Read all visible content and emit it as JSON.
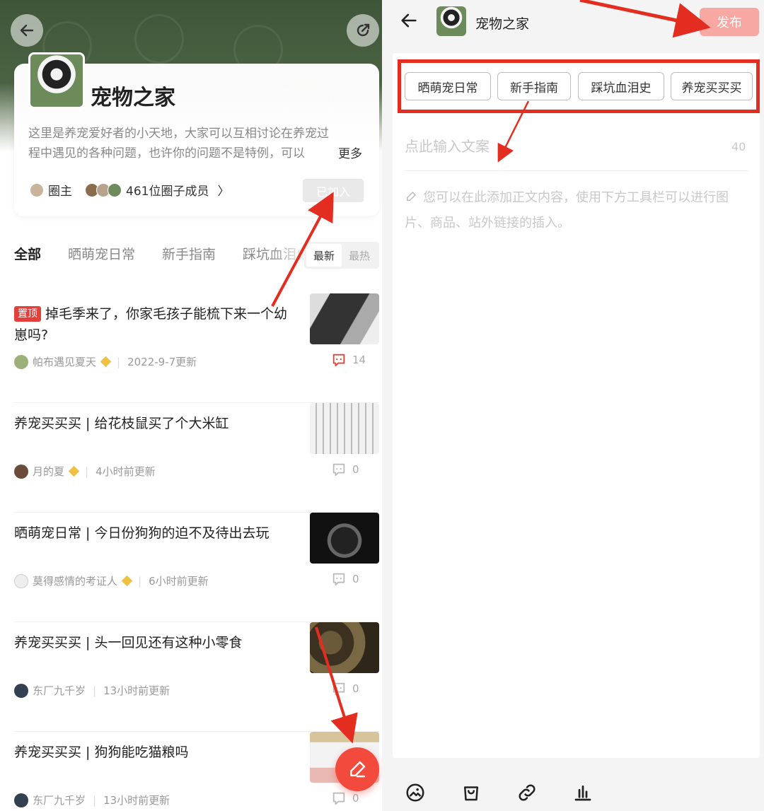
{
  "left": {
    "group": {
      "name": "宠物之家",
      "description": "这里是养宠爱好者的小天地，大家可以互相讨论在养宠过程中遇见的各种问题，也许你的问题不是特例，可以",
      "more_label": "更多",
      "owner_label": "圈主",
      "members_label": "461位圈子成员",
      "members_chevron": "〉",
      "join_status": "已加入"
    },
    "tabs": [
      "全部",
      "晒萌宠日常",
      "新手指南",
      "踩坑血泪史"
    ],
    "sort": {
      "latest": "最新",
      "hottest": "最热"
    },
    "posts": [
      {
        "pinned": true,
        "pin_label": "置顶",
        "title": "掉毛季来了，你家毛孩子能梳下来一个幼崽吗?",
        "author": "帕布遇见夏天",
        "time": "2022-9-7更新",
        "comments": "14",
        "comment_color": "#e2403a"
      },
      {
        "pinned": false,
        "title": "养宠买买买 | 给花枝鼠买了个大米缸",
        "author": "月的夏",
        "time": "4小时前更新",
        "comments": "0",
        "comment_color": "#bbbbbb"
      },
      {
        "pinned": false,
        "title": "晒萌宠日常 | 今日份狗狗的迫不及待出去玩",
        "author": "莫得感情的考证人",
        "time": "6小时前更新",
        "comments": "0",
        "comment_color": "#bbbbbb"
      },
      {
        "pinned": false,
        "title": "养宠买买买 | 头一回见还有这种小零食",
        "author": "东厂九千岁",
        "time": "13小时前更新",
        "comments": "0",
        "comment_color": "#bbbbbb"
      },
      {
        "pinned": false,
        "title": "养宠买买买 | 狗狗能吃猫粮吗",
        "author": "东厂九千岁",
        "time": "13小时前更新",
        "comments": "0",
        "comment_color": "#bbbbbb"
      }
    ]
  },
  "right": {
    "header_title": "宠物之家",
    "publish_label": "发布",
    "topics": [
      "晒萌宠日常",
      "新手指南",
      "踩坑血泪史",
      "养宠买买买"
    ],
    "title_placeholder": "点此输入文案",
    "title_limit": "40",
    "body_placeholder": "您可以在此添加正文内容，使用下方工具栏可以进行图片、商品、站外链接的插入。",
    "toolbar_icons": [
      "image-icon",
      "shopping-bag-icon",
      "link-icon",
      "chart-icon"
    ]
  },
  "colors": {
    "accent_red": "#e2403a",
    "annotation_red": "#e32d20",
    "publish_disabled": "#f7a8a2"
  }
}
